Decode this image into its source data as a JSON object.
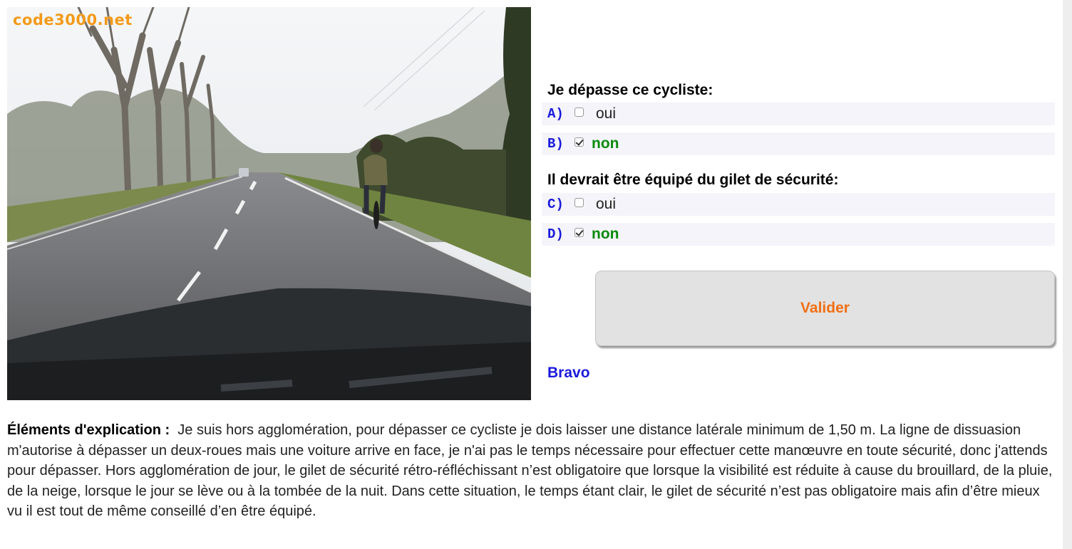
{
  "photo": {
    "watermark": "code3000.net"
  },
  "questions": [
    {
      "text": "Je dépasse ce cycliste:",
      "answers": [
        {
          "letter": "A)",
          "label": "oui",
          "checked": false
        },
        {
          "letter": "B)",
          "label": "non",
          "checked": true
        }
      ]
    },
    {
      "text": "Il devrait être équipé du gilet de sécurité:",
      "answers": [
        {
          "letter": "C)",
          "label": "oui",
          "checked": false
        },
        {
          "letter": "D)",
          "label": "non",
          "checked": true
        }
      ]
    }
  ],
  "validate_label": "Valider",
  "result": "Bravo",
  "explanation": {
    "label": "Éléments d'explication :",
    "text": "Je suis hors agglomération, pour dépasser ce cycliste je dois laisser une distance latérale minimum de 1,50 m. La ligne de dissuasion m'autorise à dépasser un deux-roues mais une voiture arrive en face, je n'ai pas le temps nécessaire pour effectuer cette manœuvre en toute sécurité, donc j'attends pour dépasser. Hors agglomération de jour, le gilet de sécurité rétro-réfléchissant n’est obligatoire que lorsque la visibilité est réduite à cause du brouillard, de la pluie, de la neige, lorsque le jour se lève ou à la tombée de la nuit. Dans cette situation, le temps étant clair, le gilet de sécurité n’est pas obligatoire mais afin d’être mieux vu il est tout de même conseillé d’en être équipé."
  },
  "colors": {
    "letter": "#1a1adc",
    "correct": "#0a8a0a",
    "validate_text": "#f26f10",
    "result": "#1a1adc",
    "watermark": "#f39a1a"
  }
}
